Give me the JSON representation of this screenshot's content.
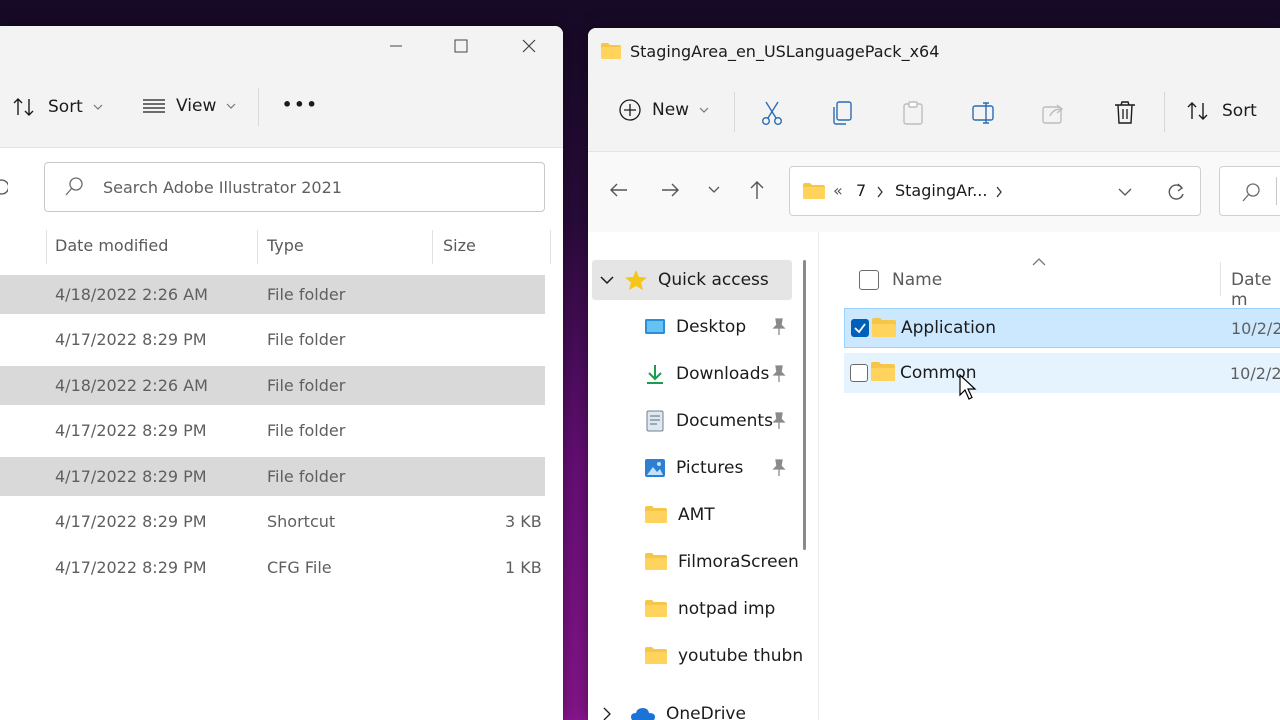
{
  "left_window": {
    "toolbar": {
      "sort_label": "Sort",
      "view_label": "View",
      "more_label": "•••"
    },
    "search": {
      "placeholder": "Search Adobe Illustrator 2021"
    },
    "columns": {
      "date": "Date modified",
      "type": "Type",
      "size": "Size"
    },
    "rows": [
      {
        "date": "4/18/2022 2:26 AM",
        "type": "File folder",
        "size": ""
      },
      {
        "date": "4/17/2022 8:29 PM",
        "type": "File folder",
        "size": ""
      },
      {
        "date": "4/18/2022 2:26 AM",
        "type": "File folder",
        "size": ""
      },
      {
        "date": "4/17/2022 8:29 PM",
        "type": "File folder",
        "size": ""
      },
      {
        "date": "4/17/2022 8:29 PM",
        "type": "File folder",
        "size": ""
      },
      {
        "date": "4/17/2022 8:29 PM",
        "type": "Shortcut",
        "size": "3 KB"
      },
      {
        "date": "4/17/2022 8:29 PM",
        "type": "CFG File",
        "size": "1 KB"
      }
    ]
  },
  "right_window": {
    "title": "StagingArea_en_USLanguagePack_x64",
    "toolbar": {
      "new_label": "New",
      "sort_label": "Sort"
    },
    "address": {
      "overflow": "«",
      "crumbs": [
        "7",
        "StagingAr..."
      ]
    },
    "nav": {
      "quick_access": "Quick access",
      "items": [
        {
          "label": "Desktop",
          "icon": "desktop-icon",
          "pinned": true
        },
        {
          "label": "Downloads",
          "icon": "download-icon",
          "pinned": true
        },
        {
          "label": "Documents",
          "icon": "documents-icon",
          "pinned": true
        },
        {
          "label": "Pictures",
          "icon": "pictures-icon",
          "pinned": true
        },
        {
          "label": "AMT",
          "icon": "folder-icon",
          "pinned": false
        },
        {
          "label": "FilmoraScreen",
          "icon": "folder-icon",
          "pinned": false
        },
        {
          "label": "notpad imp",
          "icon": "folder-icon",
          "pinned": false
        },
        {
          "label": "youtube thubn",
          "icon": "folder-icon",
          "pinned": false
        }
      ],
      "onedrive": "OneDrive"
    },
    "columns": {
      "name": "Name",
      "date": "Date m"
    },
    "files": [
      {
        "name": "Application",
        "date": "10/2/2",
        "checked": true
      },
      {
        "name": "Common",
        "date": "10/2/2",
        "checked": false
      }
    ]
  },
  "colors": {
    "accent": "#005fb8",
    "folder": "#f5c648",
    "selection": "#cce8ff"
  }
}
